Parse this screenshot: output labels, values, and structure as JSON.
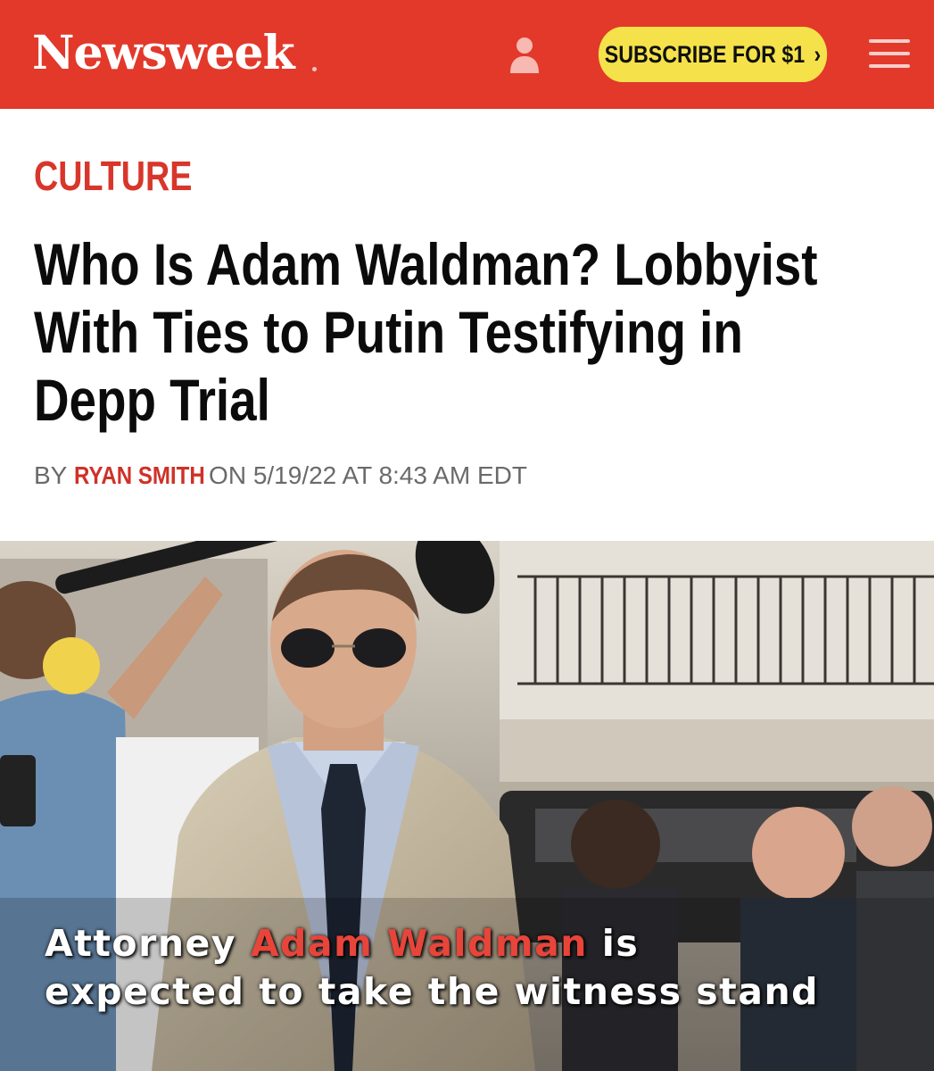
{
  "header": {
    "logo": "Newsweek",
    "subscribe_label": "SUBSCRIBE FOR $1",
    "subscribe_chevron": "›",
    "icons": [
      "user-icon",
      "menu-icon"
    ],
    "brand_color": "#e2392b",
    "button_color": "#f5e24a"
  },
  "article": {
    "category": "CULTURE",
    "headline_line1": "Who Is Adam Waldman? Lobbyist",
    "headline_line2": "With Ties to Putin Testifying in",
    "headline_line3": "Depp Trial",
    "byline_prefix": "BY",
    "author": "RYAN SMITH",
    "byline_suffix": "ON 5/19/22 AT 8:43 AM EDT",
    "accent_color": "#d8362b"
  },
  "photo": {
    "caption_word1": "Attorney",
    "caption_name": "Adam Waldman",
    "caption_word2": "is",
    "caption_line2": "expected to take the witness stand"
  }
}
